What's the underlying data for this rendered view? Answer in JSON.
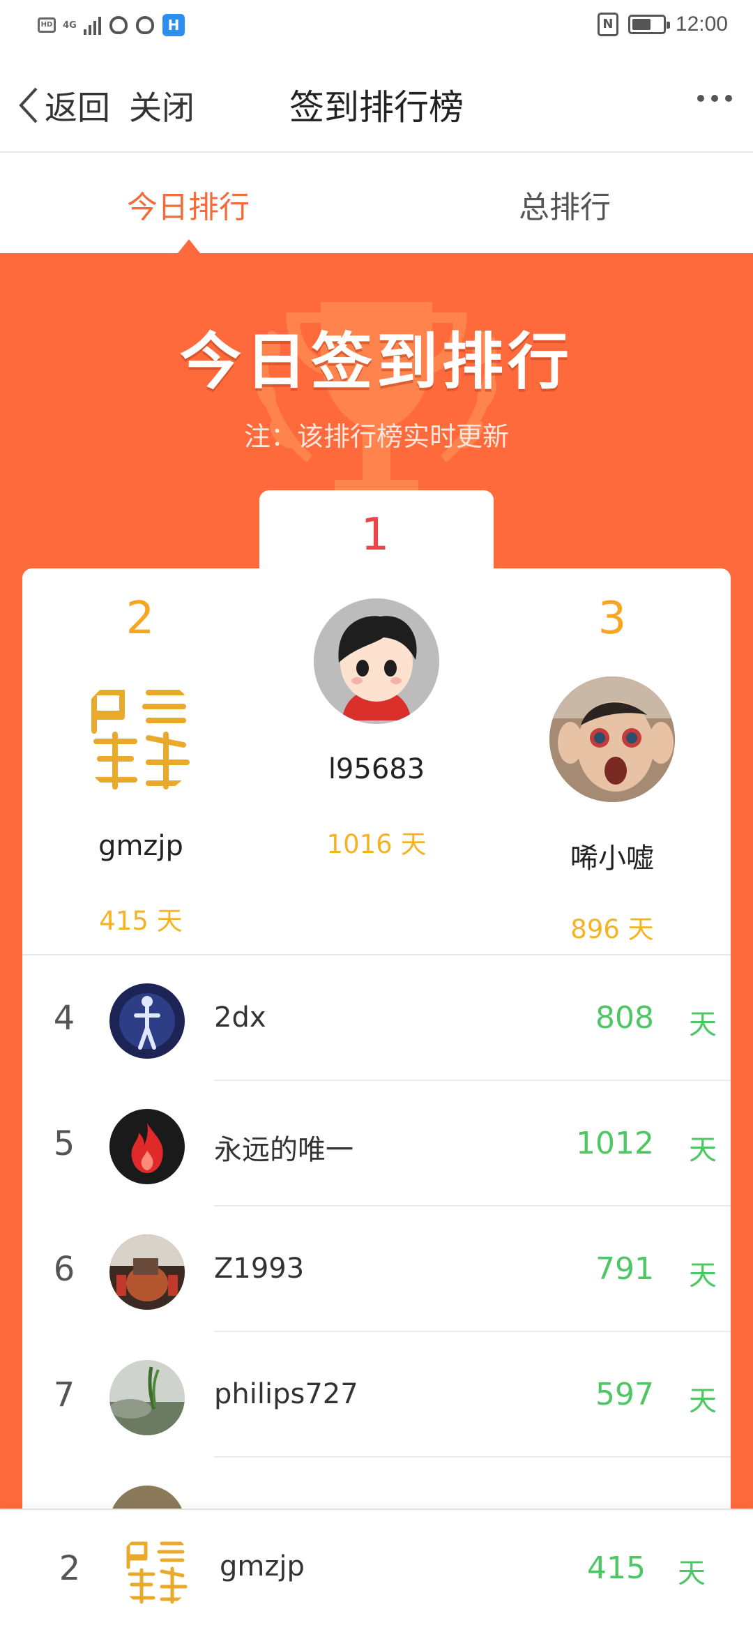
{
  "status_bar": {
    "hd": "HD",
    "network": "4G",
    "app_icon": "H",
    "nfc": "N",
    "time": "12:00"
  },
  "nav": {
    "back_label": "返回",
    "close_label": "关闭",
    "title": "签到排行榜"
  },
  "tabs": [
    {
      "label": "今日排行",
      "active": true
    },
    {
      "label": "总排行",
      "active": false
    }
  ],
  "banner": {
    "title": "今日签到排行",
    "note": "注：该排行榜实时更新"
  },
  "podium": [
    {
      "rank": "1",
      "name": "l95683",
      "days": "1016 天"
    },
    {
      "rank": "2",
      "name": "gmzjp",
      "days": "415 天"
    },
    {
      "rank": "3",
      "name": "唏小嘘",
      "days": "896 天"
    }
  ],
  "list": [
    {
      "rank": "4",
      "name": "2dx",
      "days": "808",
      "unit": "天"
    },
    {
      "rank": "5",
      "name": "永远的唯一",
      "days": "1012",
      "unit": "天"
    },
    {
      "rank": "6",
      "name": "Z1993",
      "days": "791",
      "unit": "天"
    },
    {
      "rank": "7",
      "name": "philips727",
      "days": "597",
      "unit": "天"
    }
  ],
  "my_rank": {
    "rank": "2",
    "name": "gmzjp",
    "days": "415",
    "unit": "天"
  },
  "colors": {
    "accent": "#ff6a3d",
    "tab_active": "#f26b3a",
    "gold": "#f5a623",
    "first": "#e8464a",
    "green": "#4cc764"
  }
}
